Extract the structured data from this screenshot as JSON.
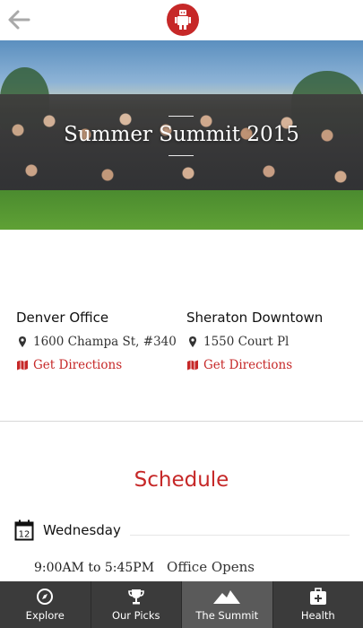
{
  "hero": {
    "title": "Summer Summit 2015"
  },
  "locations": [
    {
      "name": "Denver Office",
      "address": "1600 Champa St, #340",
      "directions": "Get Directions"
    },
    {
      "name": "Sheraton Downtown",
      "address": "1550 Court Pl",
      "directions": "Get Directions"
    }
  ],
  "schedule": {
    "title": "Schedule",
    "calendar_day": "12",
    "day": "Wednesday",
    "events": [
      {
        "time": "9:00AM to 5:45PM",
        "name": "Office Opens"
      }
    ]
  },
  "tabs": [
    {
      "label": "Explore",
      "icon": "compass-icon",
      "active": false
    },
    {
      "label": "Our Picks",
      "icon": "trophy-icon",
      "active": false
    },
    {
      "label": "The Summit",
      "icon": "mountain-icon",
      "active": true
    },
    {
      "label": "Health",
      "icon": "medical-kit-icon",
      "active": false
    }
  ],
  "colors": {
    "accent": "#c62828",
    "tabbar": "#3b3b3b",
    "tab_active": "#5a5a5a"
  }
}
